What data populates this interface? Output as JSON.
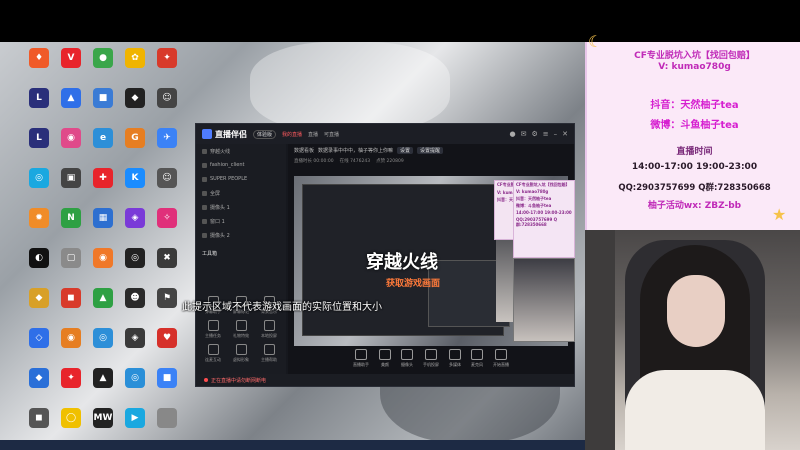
{
  "desktop": {
    "icons": [
      {
        "label": "",
        "color": "#f05a28",
        "glyph": "♦"
      },
      {
        "label": "",
        "color": "#e8242b",
        "glyph": "V"
      },
      {
        "label": "",
        "color": "#3aa64a",
        "glyph": "●"
      },
      {
        "label": "",
        "color": "#f0b400",
        "glyph": "✿"
      },
      {
        "label": "",
        "color": "#d83a2a",
        "glyph": "✦"
      },
      {
        "label": "",
        "color": "#2a2f7a",
        "glyph": "L"
      },
      {
        "label": "",
        "color": "#2f6fe8",
        "glyph": "▲"
      },
      {
        "label": "",
        "color": "#3a7bd5",
        "glyph": "■"
      },
      {
        "label": "",
        "color": "#222",
        "glyph": "◆"
      },
      {
        "label": "",
        "color": "#444",
        "glyph": "☺"
      },
      {
        "label": "",
        "color": "#2a2f7a",
        "glyph": "L"
      },
      {
        "label": "",
        "color": "#e04a8a",
        "glyph": "◉"
      },
      {
        "label": "",
        "color": "#2d8fd8",
        "glyph": "e"
      },
      {
        "label": "",
        "color": "#e67e22",
        "glyph": "G"
      },
      {
        "label": "",
        "color": "#3b82f6",
        "glyph": "✈"
      },
      {
        "label": "",
        "color": "#1aa8e0",
        "glyph": "◎"
      },
      {
        "label": "",
        "color": "#444",
        "glyph": "▣"
      },
      {
        "label": "",
        "color": "#e8242b",
        "glyph": "✚"
      },
      {
        "label": "",
        "color": "#1a8cff",
        "glyph": "K"
      },
      {
        "label": "",
        "color": "#555",
        "glyph": "☺"
      },
      {
        "label": "",
        "color": "#f08c28",
        "glyph": "✹"
      },
      {
        "label": "",
        "color": "#2ea043",
        "glyph": "N"
      },
      {
        "label": "",
        "color": "#2d6fd0",
        "glyph": "▦"
      },
      {
        "label": "",
        "color": "#7a3ad8",
        "glyph": "◈"
      },
      {
        "label": "",
        "color": "#e0307a",
        "glyph": "✧"
      },
      {
        "label": "",
        "color": "#111",
        "glyph": "◐"
      },
      {
        "label": "",
        "color": "#8a8a8a",
        "glyph": "▢"
      },
      {
        "label": "",
        "color": "#f07828",
        "glyph": "◉"
      },
      {
        "label": "",
        "color": "#222",
        "glyph": "◎"
      },
      {
        "label": "",
        "color": "#3a3a3a",
        "glyph": "✖"
      },
      {
        "label": "",
        "color": "#d8a028",
        "glyph": "◆"
      },
      {
        "label": "",
        "color": "#d83a2a",
        "glyph": "◼"
      },
      {
        "label": "",
        "color": "#2ea043",
        "glyph": "▲"
      },
      {
        "label": "",
        "color": "#2a2a2a",
        "glyph": "☻"
      },
      {
        "label": "",
        "color": "#444",
        "glyph": "⚑"
      },
      {
        "label": "",
        "color": "#2f6fe8",
        "glyph": "◇"
      },
      {
        "label": "",
        "color": "#e67e22",
        "glyph": "◉"
      },
      {
        "label": "",
        "color": "#2d8fd8",
        "glyph": "◎"
      },
      {
        "label": "",
        "color": "#3a3a3a",
        "glyph": "◈"
      },
      {
        "label": "",
        "color": "#d6302a",
        "glyph": "♥"
      },
      {
        "label": "",
        "color": "#2a6fd8",
        "glyph": "◆"
      },
      {
        "label": "",
        "color": "#e8242b",
        "glyph": "✦"
      },
      {
        "label": "",
        "color": "#222",
        "glyph": "▲"
      },
      {
        "label": "",
        "color": "#2a8fd8",
        "glyph": "◎"
      },
      {
        "label": "",
        "color": "#3b82f6",
        "glyph": "■"
      },
      {
        "label": "",
        "color": "#555",
        "glyph": "◼"
      },
      {
        "label": "",
        "color": "#f0c000",
        "glyph": "◯"
      },
      {
        "label": "",
        "color": "#222",
        "glyph": "MW"
      },
      {
        "label": "",
        "color": "#1aa8e0",
        "glyph": "▶"
      },
      {
        "label": "",
        "color": "#888",
        "glyph": ""
      }
    ]
  },
  "app": {
    "name": "直播伴侣",
    "badge": "体验版",
    "tabs": [
      "我的直播",
      "直播",
      "可直播"
    ],
    "active_tab": 0,
    "side_items": [
      "穿越火线",
      "fashion_client",
      "SUPER PEOPLE",
      "全屏",
      "摄像头 1",
      "窗口 1",
      "摄像头 2"
    ],
    "side_header": "工具箱",
    "tools": [
      "弹幕助手",
      "屏幕标记",
      "背景音乐",
      "主播任务",
      "礼物特效",
      "本地投屏",
      "连麦互动",
      "虚拟形象",
      "主播帮助"
    ],
    "announce_label": "数据看板",
    "announce_text": "数据录事中中中，柚子等你上你嘛",
    "announce_tag": "设置",
    "announce_action": "设置提醒",
    "stats": [
      "直播时长 00:00:00",
      "在线 7476243",
      "点赞 220809"
    ],
    "preview_title": "穿越火线",
    "preview_sub": "获取游戏画面",
    "bottom_tools": [
      "直播助手",
      "美颜",
      "摄像头",
      "手机投屏",
      "多媒体",
      "麦克风",
      "开始直播"
    ],
    "status_text": "正在直播中请勿断网断电"
  },
  "overlay_hint": "此提示区域不代表游戏画面的实际位置和大小",
  "info_panel": {
    "line1": "CF专业脱坑入坑【找回包赔】",
    "line2": "V: kumao780g",
    "line3": "抖音：天然柚子tea",
    "line4": "微博：斗鱼柚子tea",
    "line5": "直播时间",
    "line6": "14:00-17:00  19:00-23:00",
    "line7": "QQ:2903757699  Q群:728350668",
    "line8": "柚子活动wx: ZBZ-bb",
    "color_accent": "#c02ab8"
  }
}
